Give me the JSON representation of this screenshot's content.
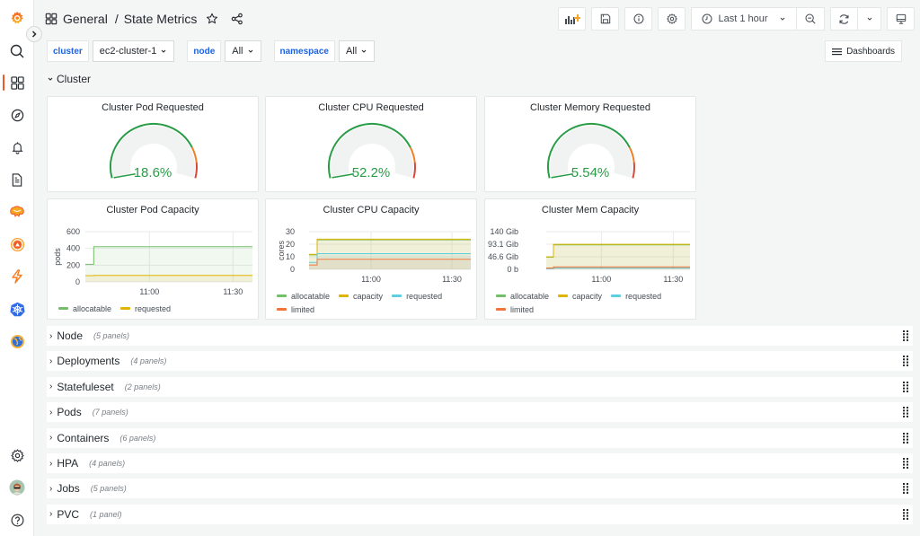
{
  "header": {
    "breadcrumb_folder": "General",
    "breadcrumb_separator": "/",
    "dashboard_title": "State Metrics"
  },
  "toolbar": {
    "time_range": "Last 1 hour",
    "dashboards_label": "Dashboards"
  },
  "variables": [
    {
      "label": "cluster",
      "value": "ec2-cluster-1"
    },
    {
      "label": "node",
      "value": "All"
    },
    {
      "label": "namespace",
      "value": "All"
    }
  ],
  "cluster_row": {
    "title": "Cluster"
  },
  "gauges": [
    {
      "title": "Cluster Pod Requested",
      "value": "18.6%",
      "percent": 18.6
    },
    {
      "title": "Cluster CPU Requested",
      "value": "52.2%",
      "percent": 52.2
    },
    {
      "title": "Cluster Memory Requested",
      "value": "5.54%",
      "percent": 5.54
    }
  ],
  "colors": {
    "green": "#299c46",
    "orange": "#ed8128",
    "red": "#d44a3a",
    "accent": "#f05a28",
    "link_blue": "#1f62e0",
    "allocatable": "#73bf69",
    "capacity": "#e0b400",
    "requested": "#5ecfde",
    "limited": "#f2743a"
  },
  "chart_data": [
    {
      "type": "line",
      "title": "Cluster Pod Capacity",
      "ylabel": "pods",
      "yticks": [
        "0",
        "200",
        "400",
        "600"
      ],
      "ylim": [
        0,
        600
      ],
      "xticks": [
        "11:00",
        "11:30"
      ],
      "x": [
        "10:37",
        "10:40",
        "11:00",
        "11:30",
        "11:37"
      ],
      "series": [
        {
          "name": "allocatable",
          "color": "#73bf69",
          "values": [
            210,
            420,
            420,
            420,
            420
          ]
        },
        {
          "name": "requested",
          "color": "#e0b400",
          "values": [
            75,
            78,
            78,
            78,
            78
          ]
        }
      ]
    },
    {
      "type": "line",
      "title": "Cluster CPU Capacity",
      "ylabel": "cores",
      "yticks": [
        "0",
        "10",
        "20",
        "30"
      ],
      "ylim": [
        0,
        30
      ],
      "xticks": [
        "11:00",
        "11:30"
      ],
      "x": [
        "10:37",
        "10:40",
        "11:00",
        "11:30",
        "11:37"
      ],
      "series": [
        {
          "name": "allocatable",
          "color": "#73bf69",
          "values": [
            11.5,
            23.5,
            23.5,
            23.5,
            23.5
          ]
        },
        {
          "name": "capacity",
          "color": "#e0b400",
          "values": [
            12,
            24,
            24,
            24,
            24
          ]
        },
        {
          "name": "requested",
          "color": "#5ecfde",
          "values": [
            5.5,
            12.5,
            12.5,
            12.5,
            12.5
          ]
        },
        {
          "name": "limited",
          "color": "#f2743a",
          "values": [
            3.5,
            8,
            8,
            8,
            8
          ]
        }
      ]
    },
    {
      "type": "line",
      "title": "Cluster Mem Capacity",
      "ylabel": "",
      "yticks": [
        "0 b",
        "46.6 Gib",
        "93.1 Gib",
        "140 Gib"
      ],
      "ylim": [
        0,
        140
      ],
      "xticks": [
        "11:00",
        "11:30"
      ],
      "x": [
        "10:37",
        "10:40",
        "11:00",
        "11:30",
        "11:37"
      ],
      "series": [
        {
          "name": "allocatable",
          "color": "#73bf69",
          "values": [
            45,
            91,
            91,
            91,
            91
          ]
        },
        {
          "name": "capacity",
          "color": "#e0b400",
          "values": [
            46.6,
            93.1,
            93.1,
            93.1,
            93.1
          ]
        },
        {
          "name": "requested",
          "color": "#5ecfde",
          "values": [
            3,
            5,
            5,
            5,
            5
          ]
        },
        {
          "name": "limited",
          "color": "#f2743a",
          "values": [
            5,
            9,
            9,
            9,
            9
          ]
        }
      ]
    }
  ],
  "collapsed_rows": [
    {
      "title": "Node",
      "count": "(5 panels)"
    },
    {
      "title": "Deployments",
      "count": "(4 panels)"
    },
    {
      "title": "Statefuleset",
      "count": "(2 panels)"
    },
    {
      "title": "Pods",
      "count": "(7 panels)"
    },
    {
      "title": "Containers",
      "count": "(6 panels)"
    },
    {
      "title": "HPA",
      "count": "(4 panels)"
    },
    {
      "title": "Jobs",
      "count": "(5 panels)"
    },
    {
      "title": "PVC",
      "count": "(1 panel)"
    }
  ]
}
